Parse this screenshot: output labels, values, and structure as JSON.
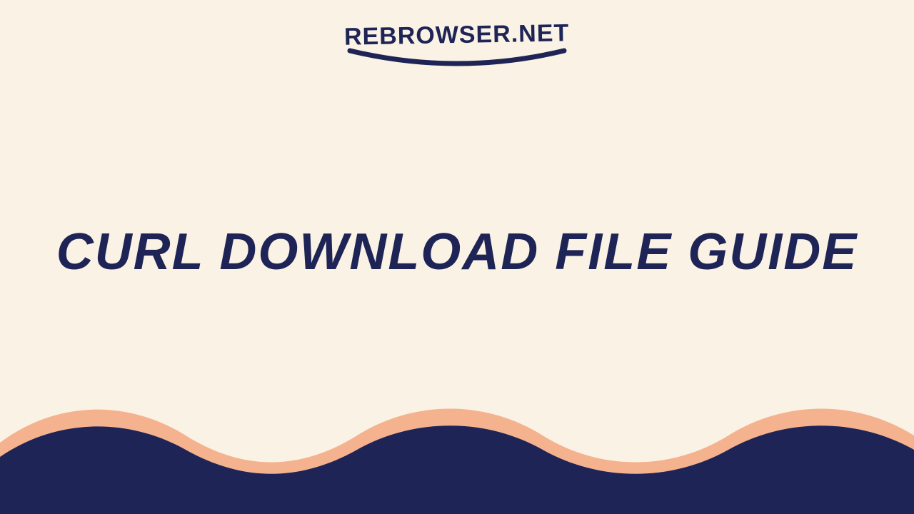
{
  "brand": {
    "name": "REBROWSER.NET"
  },
  "headline": {
    "text": "CURL DOWNLOAD FILE GUIDE"
  },
  "colors": {
    "background": "#faf2e5",
    "navy": "#1e2456",
    "peach": "#f5b28e"
  }
}
